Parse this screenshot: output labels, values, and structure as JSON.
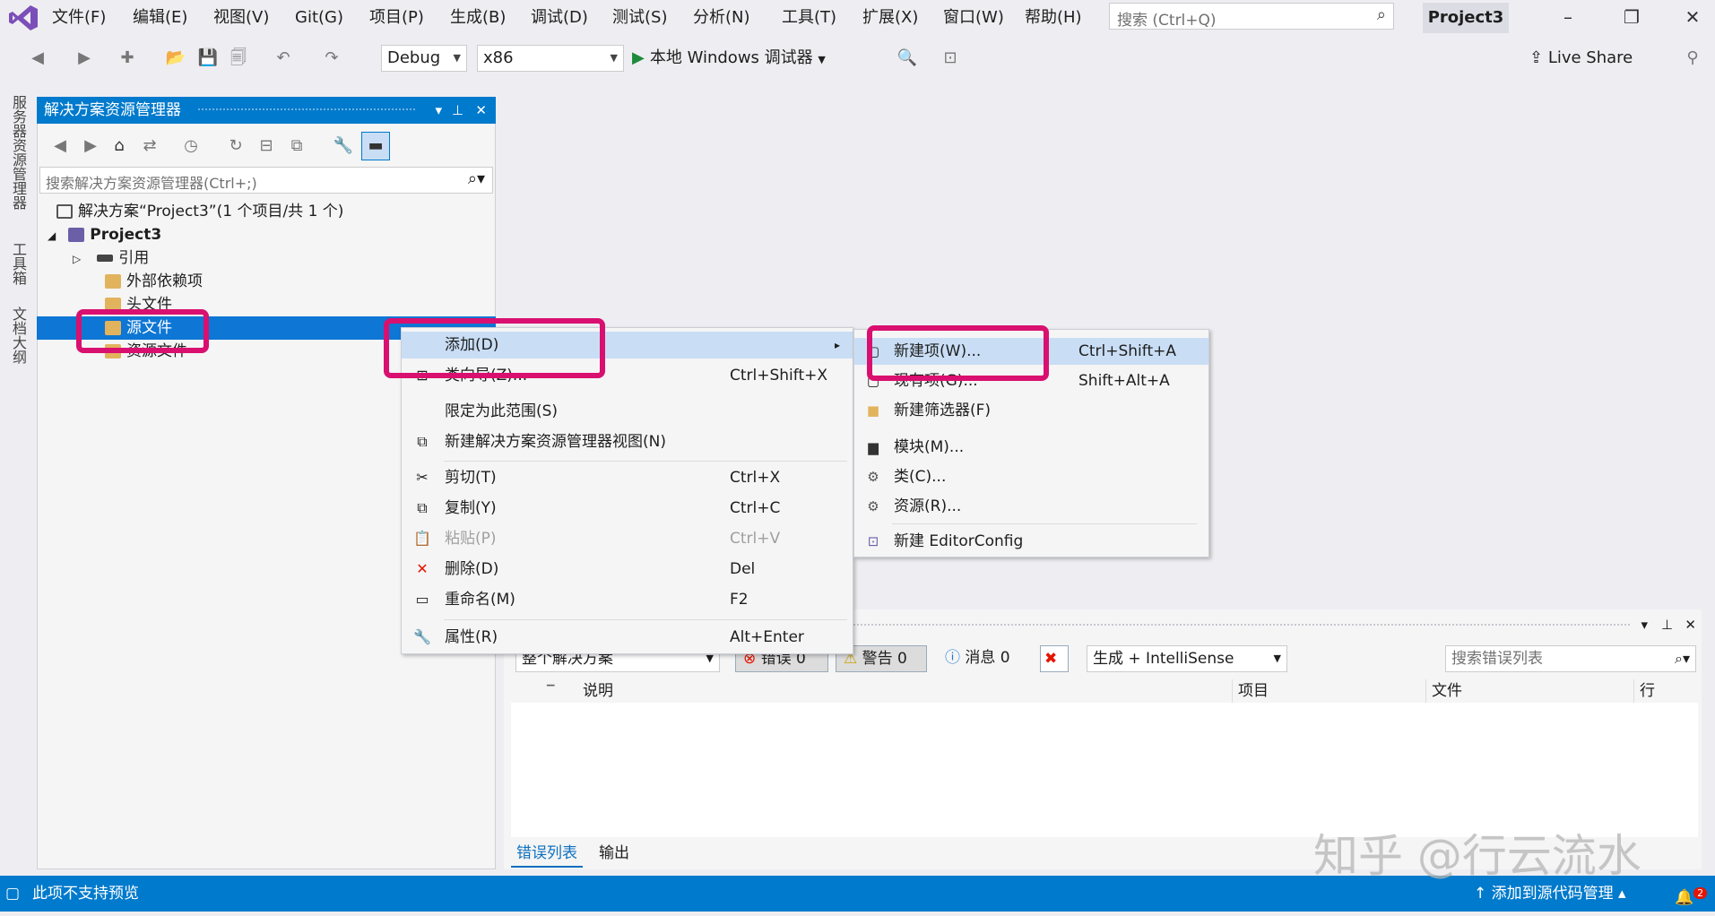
{
  "menubar": {
    "items": [
      "文件(F)",
      "编辑(E)",
      "视图(V)",
      "Git(G)",
      "项目(P)",
      "生成(B)",
      "调试(D)",
      "测试(S)",
      "分析(N)",
      "工具(T)",
      "扩展(X)",
      "窗口(W)",
      "帮助(H)"
    ],
    "search_placeholder": "搜索 (Ctrl+Q)",
    "project_name": "Project3"
  },
  "toolbar": {
    "config": "Debug",
    "platform": "x86",
    "run_label": "本地 Windows 调试器",
    "live_share": "Live Share"
  },
  "left_strip": [
    "服务器资源管理器",
    "工具箱",
    "文档大纲"
  ],
  "solution_explorer": {
    "title": "解决方案资源管理器",
    "search_placeholder": "搜索解决方案资源管理器(Ctrl+;)",
    "tree": [
      {
        "label": "解决方案“Project3”(1 个项目/共 1 个)",
        "indent": 0
      },
      {
        "label": "Project3",
        "indent": 1
      },
      {
        "label": "引用",
        "indent": 2
      },
      {
        "label": "外部依赖项",
        "indent": 2
      },
      {
        "label": "头文件",
        "indent": 2
      },
      {
        "label": "源文件",
        "indent": 2
      },
      {
        "label": "资源文件",
        "indent": 2
      }
    ]
  },
  "context_menu": {
    "items": [
      {
        "label": "添加(D)",
        "shortcut": ""
      },
      {
        "label": "类向导(Z)...",
        "shortcut": "Ctrl+Shift+X"
      },
      {
        "label": "限定为此范围(S)",
        "shortcut": ""
      },
      {
        "label": "新建解决方案资源管理器视图(N)",
        "shortcut": ""
      },
      {
        "label": "剪切(T)",
        "shortcut": "Ctrl+X"
      },
      {
        "label": "复制(Y)",
        "shortcut": "Ctrl+C"
      },
      {
        "label": "粘贴(P)",
        "shortcut": "Ctrl+V"
      },
      {
        "label": "删除(D)",
        "shortcut": "Del"
      },
      {
        "label": "重命名(M)",
        "shortcut": "F2"
      },
      {
        "label": "属性(R)",
        "shortcut": "Alt+Enter"
      }
    ]
  },
  "submenu": {
    "items": [
      {
        "label": "新建项(W)...",
        "shortcut": "Ctrl+Shift+A"
      },
      {
        "label": "现有项(G)...",
        "shortcut": "Shift+Alt+A"
      },
      {
        "label": "新建筛选器(F)",
        "shortcut": ""
      },
      {
        "label": "模块(M)...",
        "shortcut": ""
      },
      {
        "label": "类(C)...",
        "shortcut": ""
      },
      {
        "label": "资源(R)...",
        "shortcut": ""
      },
      {
        "label": "新建 EditorConfig",
        "shortcut": ""
      }
    ]
  },
  "error_list": {
    "scope": "整个解决方案",
    "errors": "错误 0",
    "warnings": "警告 0",
    "messages": "消息 0",
    "build_filter": "生成 + IntelliSense",
    "search_placeholder": "搜索错误列表",
    "columns": [
      "说明",
      "项目",
      "文件",
      "行"
    ],
    "tabs": [
      "错误列表",
      "输出"
    ]
  },
  "status": {
    "left": "此项不支持预览",
    "right": "添加到源代码管理",
    "notifications": "2"
  },
  "watermark": "知乎 @行云流水",
  "colors": {
    "accent": "#007acc",
    "highlight": "#d9106f",
    "selection": "#0e76d4",
    "menu_hover": "#c9def5"
  }
}
